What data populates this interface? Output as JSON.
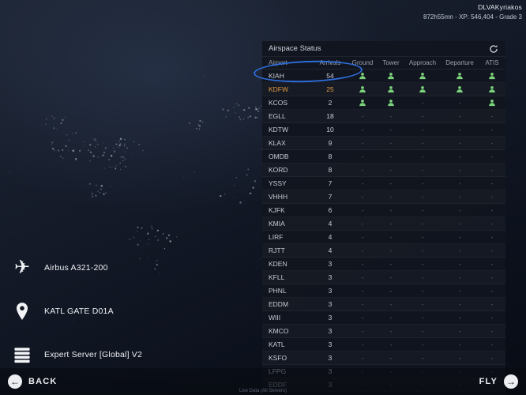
{
  "topbar": {
    "username": "DLVAKyriakos",
    "stats": "872h55mn - XP: 546,404 - Grade 3"
  },
  "airspace": {
    "title": "Airspace Status",
    "columns": [
      "Airport",
      "Arrivals",
      "Ground",
      "Tower",
      "Approach",
      "Departure",
      "ATIS"
    ],
    "status_colors": {
      "active": "#7bd37c"
    },
    "inactive_symbol": "-",
    "rows": [
      {
        "airport": "KIAH",
        "arrivals": 54,
        "facilities": [
          1,
          1,
          1,
          1,
          1
        ]
      },
      {
        "airport": "KDFW",
        "arrivals": 25,
        "facilities": [
          1,
          1,
          1,
          1,
          1
        ],
        "highlight": "orange"
      },
      {
        "airport": "KCOS",
        "arrivals": 2,
        "facilities": [
          1,
          1,
          0,
          0,
          1
        ]
      },
      {
        "airport": "EGLL",
        "arrivals": 18,
        "facilities": [
          0,
          0,
          0,
          0,
          0
        ]
      },
      {
        "airport": "KDTW",
        "arrivals": 10,
        "facilities": [
          0,
          0,
          0,
          0,
          0
        ]
      },
      {
        "airport": "KLAX",
        "arrivals": 9,
        "facilities": [
          0,
          0,
          0,
          0,
          0
        ]
      },
      {
        "airport": "OMDB",
        "arrivals": 8,
        "facilities": [
          0,
          0,
          0,
          0,
          0
        ]
      },
      {
        "airport": "KORD",
        "arrivals": 8,
        "facilities": [
          0,
          0,
          0,
          0,
          0
        ]
      },
      {
        "airport": "YSSY",
        "arrivals": 7,
        "facilities": [
          0,
          0,
          0,
          0,
          0
        ]
      },
      {
        "airport": "VHHH",
        "arrivals": 7,
        "facilities": [
          0,
          0,
          0,
          0,
          0
        ]
      },
      {
        "airport": "KJFK",
        "arrivals": 6,
        "facilities": [
          0,
          0,
          0,
          0,
          0
        ]
      },
      {
        "airport": "KMIA",
        "arrivals": 4,
        "facilities": [
          0,
          0,
          0,
          0,
          0
        ]
      },
      {
        "airport": "LIRF",
        "arrivals": 4,
        "facilities": [
          0,
          0,
          0,
          0,
          0
        ]
      },
      {
        "airport": "RJTT",
        "arrivals": 4,
        "facilities": [
          0,
          0,
          0,
          0,
          0
        ]
      },
      {
        "airport": "KDEN",
        "arrivals": 3,
        "facilities": [
          0,
          0,
          0,
          0,
          0
        ]
      },
      {
        "airport": "KFLL",
        "arrivals": 3,
        "facilities": [
          0,
          0,
          0,
          0,
          0
        ]
      },
      {
        "airport": "PHNL",
        "arrivals": 3,
        "facilities": [
          0,
          0,
          0,
          0,
          0
        ]
      },
      {
        "airport": "EDDM",
        "arrivals": 3,
        "facilities": [
          0,
          0,
          0,
          0,
          0
        ]
      },
      {
        "airport": "WIII",
        "arrivals": 3,
        "facilities": [
          0,
          0,
          0,
          0,
          0
        ]
      },
      {
        "airport": "KMCO",
        "arrivals": 3,
        "facilities": [
          0,
          0,
          0,
          0,
          0
        ]
      },
      {
        "airport": "KATL",
        "arrivals": 3,
        "facilities": [
          0,
          0,
          0,
          0,
          0
        ]
      },
      {
        "airport": "KSFO",
        "arrivals": 3,
        "facilities": [
          0,
          0,
          0,
          0,
          0
        ]
      },
      {
        "airport": "LFPG",
        "arrivals": 3,
        "facilities": [
          0,
          0,
          0,
          0,
          0
        ]
      },
      {
        "airport": "EDDF",
        "arrivals": 3,
        "facilities": [
          0,
          0,
          0,
          0,
          0
        ]
      }
    ]
  },
  "flight_info": {
    "aircraft": "Airbus A321-200",
    "gate": "KATL GATE D01A",
    "server": "Expert Server [Global] V2"
  },
  "footer": {
    "back": "BACK",
    "fly": "FLY",
    "watermark": "Live Data (All Servers)"
  },
  "annotation": {
    "shape": "ellipse",
    "color": "#2e6cd9",
    "target": "KIAH"
  }
}
